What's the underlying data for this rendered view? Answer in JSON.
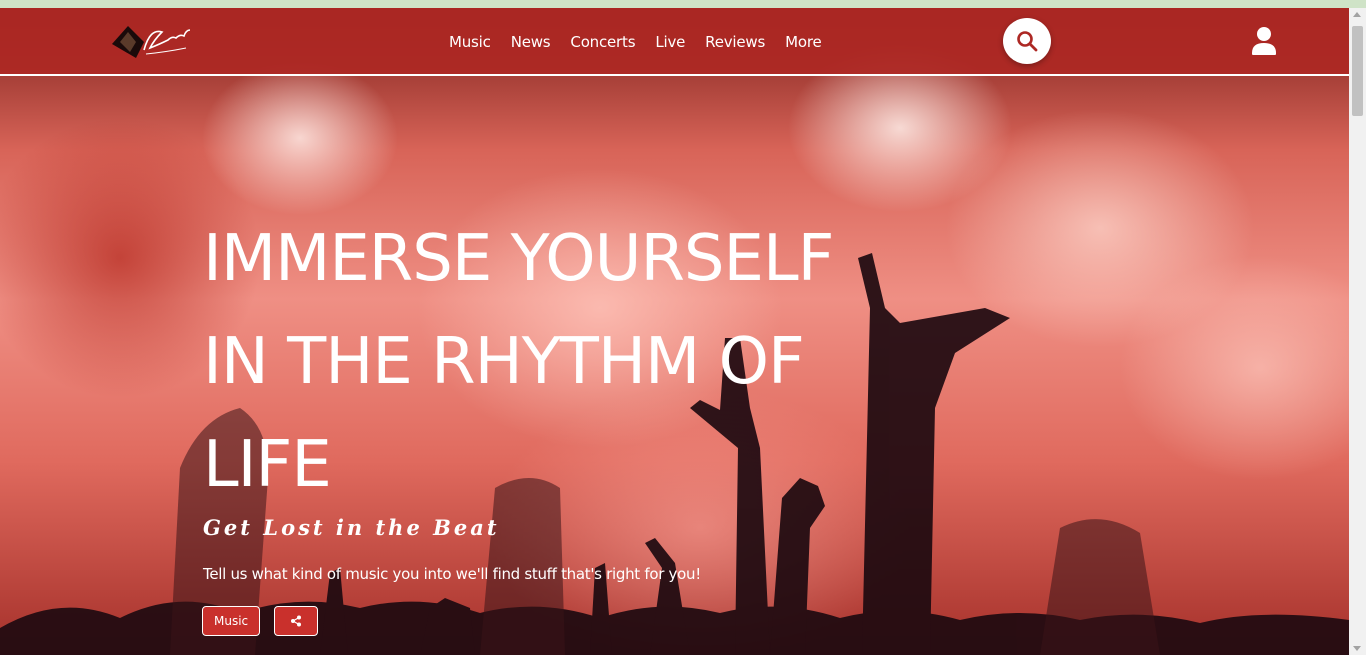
{
  "navbar": {
    "logo_icon": "brand-logo-icon",
    "links": [
      "Music",
      "News",
      "Concerts",
      "Live",
      "Reviews",
      "More"
    ],
    "search_icon": "search-icon",
    "user_icon": "user-icon"
  },
  "hero": {
    "title_lines": [
      "IMMERSE YOURSELF",
      "IN THE RHYTHM OF",
      "LIFE"
    ],
    "tagline": "Get Lost in the Beat",
    "description": "Tell us what kind of music you into we'll find stuff that's right for you!",
    "music_button": "Music",
    "share_icon": "share-icon"
  },
  "colors": {
    "navbar_bg": "#ad2824",
    "button_bg": "#c9302c",
    "accent_strip": "#cfe3c7"
  }
}
